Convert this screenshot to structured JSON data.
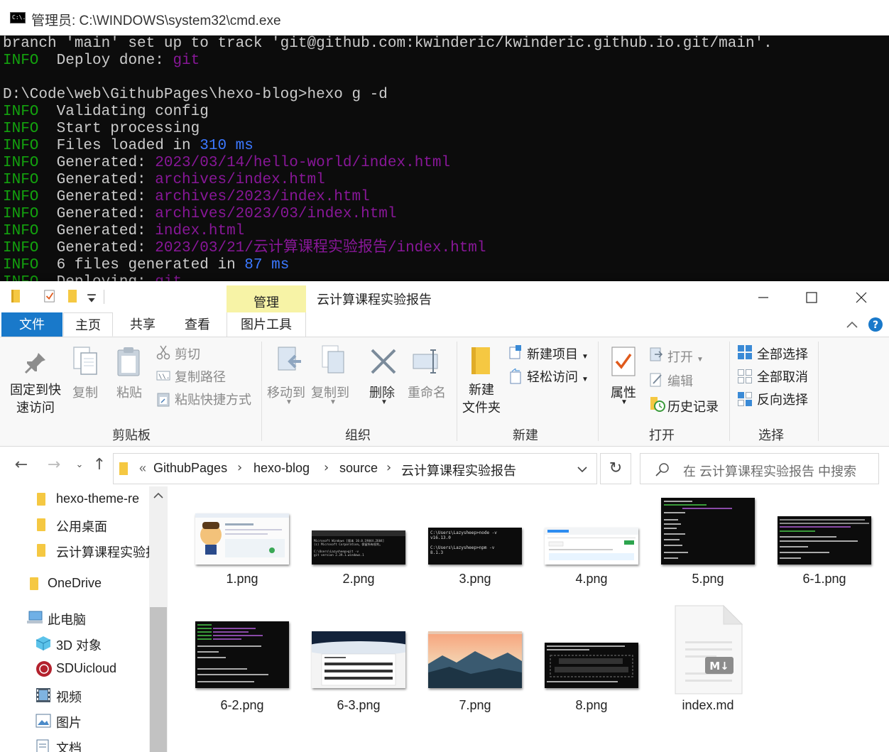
{
  "cmd": {
    "title": "管理员: C:\\WINDOWS\\system32\\cmd.exe",
    "icon_text": "C:\\.",
    "lines": [
      {
        "segs": [
          {
            "t": "branch 'main' set up to track 'git@github.com:kwinderic/kwinderic.github.io.git/main'.",
            "c": "w"
          }
        ]
      },
      {
        "segs": [
          {
            "t": "INFO",
            "c": "g"
          },
          {
            "t": "  Deploy done: ",
            "c": "w"
          },
          {
            "t": "git",
            "c": "p"
          }
        ]
      },
      {
        "segs": [
          {
            "t": "",
            "c": "w"
          }
        ]
      },
      {
        "segs": [
          {
            "t": "D:\\Code\\web\\GithubPages\\hexo-blog>hexo g -d",
            "c": "w"
          }
        ]
      },
      {
        "segs": [
          {
            "t": "INFO",
            "c": "g"
          },
          {
            "t": "  Validating config",
            "c": "w"
          }
        ]
      },
      {
        "segs": [
          {
            "t": "INFO",
            "c": "g"
          },
          {
            "t": "  Start processing",
            "c": "w"
          }
        ]
      },
      {
        "segs": [
          {
            "t": "INFO",
            "c": "g"
          },
          {
            "t": "  Files loaded in ",
            "c": "w"
          },
          {
            "t": "310 ms",
            "c": "b"
          }
        ]
      },
      {
        "segs": [
          {
            "t": "INFO",
            "c": "g"
          },
          {
            "t": "  Generated: ",
            "c": "w"
          },
          {
            "t": "2023/03/14/hello-world/index.html",
            "c": "p"
          }
        ]
      },
      {
        "segs": [
          {
            "t": "INFO",
            "c": "g"
          },
          {
            "t": "  Generated: ",
            "c": "w"
          },
          {
            "t": "archives/index.html",
            "c": "p"
          }
        ]
      },
      {
        "segs": [
          {
            "t": "INFO",
            "c": "g"
          },
          {
            "t": "  Generated: ",
            "c": "w"
          },
          {
            "t": "archives/2023/index.html",
            "c": "p"
          }
        ]
      },
      {
        "segs": [
          {
            "t": "INFO",
            "c": "g"
          },
          {
            "t": "  Generated: ",
            "c": "w"
          },
          {
            "t": "archives/2023/03/index.html",
            "c": "p"
          }
        ]
      },
      {
        "segs": [
          {
            "t": "INFO",
            "c": "g"
          },
          {
            "t": "  Generated: ",
            "c": "w"
          },
          {
            "t": "index.html",
            "c": "p"
          }
        ]
      },
      {
        "segs": [
          {
            "t": "INFO",
            "c": "g"
          },
          {
            "t": "  Generated: ",
            "c": "w"
          },
          {
            "t": "2023/03/21/云计算课程实验报告/index.html",
            "c": "p"
          }
        ]
      },
      {
        "segs": [
          {
            "t": "INFO",
            "c": "g"
          },
          {
            "t": "  6 files generated in ",
            "c": "w"
          },
          {
            "t": "87 ms",
            "c": "b"
          }
        ]
      },
      {
        "segs": [
          {
            "t": "INFO",
            "c": "g"
          },
          {
            "t": "  Deploying: ",
            "c": "w"
          },
          {
            "t": "git",
            "c": "p"
          }
        ]
      }
    ],
    "colors": {
      "bg": "#0c0c0c",
      "text": "#cccccc",
      "green": "#13a10e",
      "purple": "#881798",
      "blue": "#3b78ff"
    }
  },
  "explorer": {
    "window_title": "云计算课程实验报告",
    "contextual_tab": "管理",
    "tabs": {
      "file": "文件",
      "home": "主页",
      "share": "共享",
      "view": "查看",
      "picture_tools": "图片工具"
    },
    "ribbon": {
      "clipboard": {
        "pin": "固定到快",
        "pin2": "速访问",
        "copy": "复制",
        "paste": "粘贴",
        "cut": "剪切",
        "copy_path": "复制路径",
        "paste_shortcut": "粘贴快捷方式",
        "group": "剪贴板"
      },
      "organize": {
        "move_to": "移动到",
        "copy_to": "复制到",
        "delete": "删除",
        "rename": "重命名",
        "group": "组织"
      },
      "new": {
        "new_folder": "新建",
        "new_folder2": "文件夹",
        "new_item": "新建项目",
        "easy_access": "轻松访问",
        "group": "新建"
      },
      "open": {
        "properties": "属性",
        "open": "打开",
        "edit": "编辑",
        "history": "历史记录",
        "group": "打开"
      },
      "select": {
        "select_all": "全部选择",
        "select_none": "全部取消",
        "invert": "反向选择",
        "group": "选择"
      }
    },
    "address": {
      "prefix": "«",
      "crumbs": [
        "GithubPages",
        "hexo-blog",
        "source",
        "云计算课程实验报告"
      ]
    },
    "search_placeholder": "在 云计算课程实验报告 中搜索",
    "nav": [
      "hexo-theme-re",
      "公用桌面",
      "云计算课程实验报",
      "OneDrive",
      "此电脑",
      "3D 对象",
      "SDUicloud",
      "视频",
      "图片",
      "文档"
    ],
    "files": [
      "1.png",
      "2.png",
      "3.png",
      "4.png",
      "5.png",
      "6-1.png",
      "6-2.png",
      "6-3.png",
      "7.png",
      "8.png",
      "index.md"
    ],
    "thumb_text": {
      "t2": [
        "Microsoft Windows [版本 10.0.19044.2604]",
        "(c) Microsoft Corporation。保留所有权利。",
        "",
        "C:\\Users\\Lazysheep>git -v",
        "git version 2.39.1.windows.1"
      ],
      "t3": [
        "C:\\Users\\Lazysheep>node -v",
        "v16.13.0",
        "",
        "C:\\Users\\Lazysheep>npm -v",
        "8.1.3"
      ],
      "md": "M↓"
    },
    "accent": "#1979ca"
  }
}
